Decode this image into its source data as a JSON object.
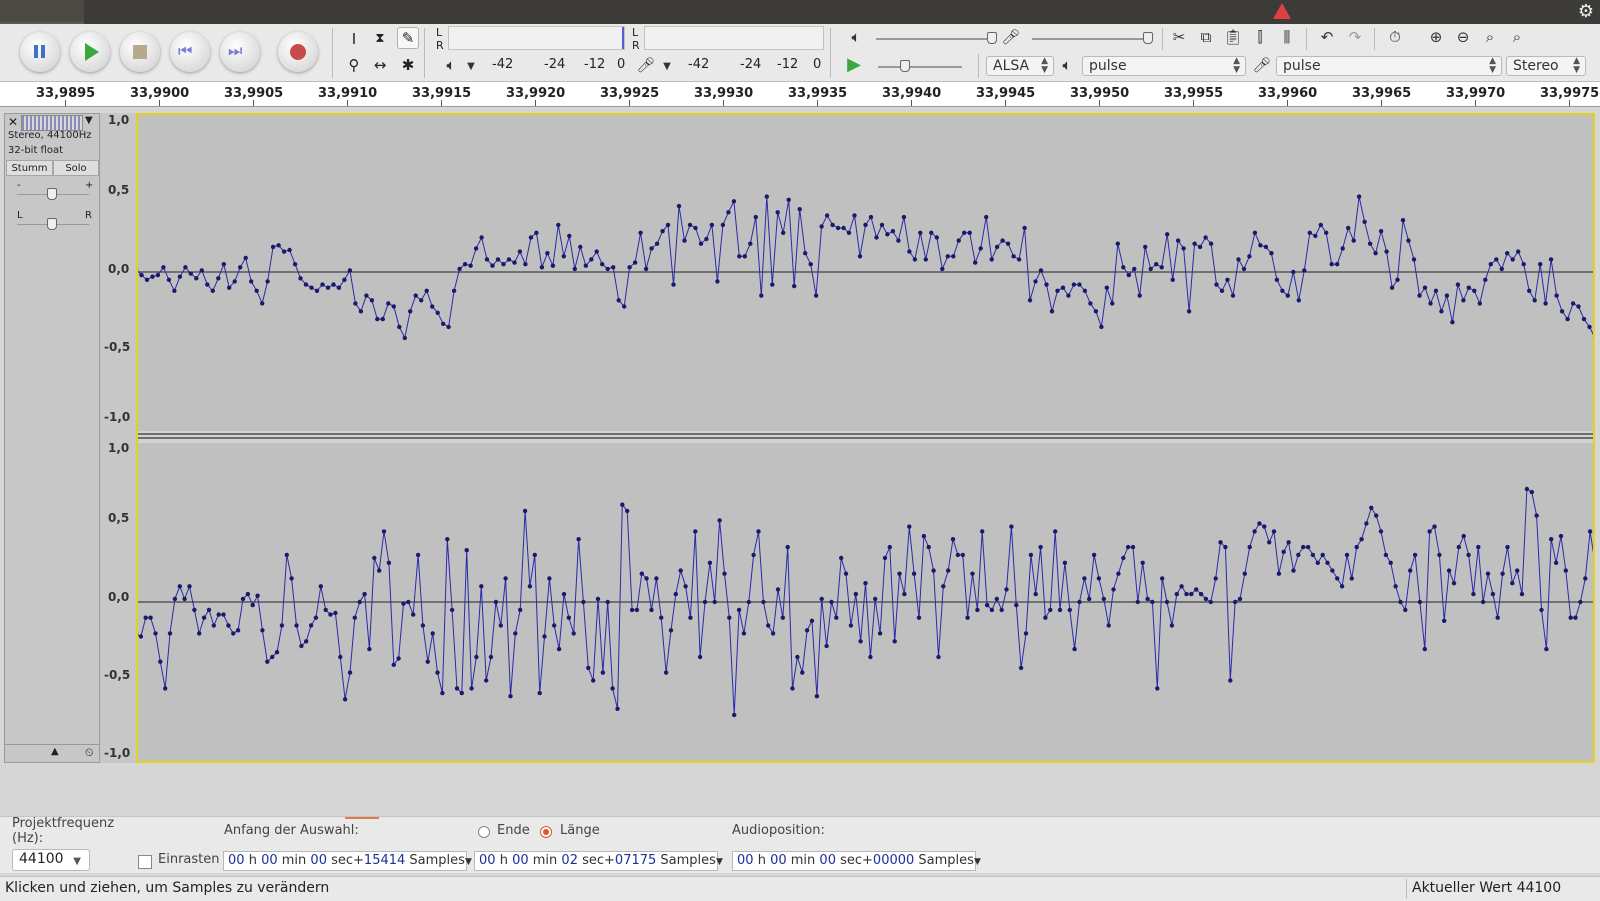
{
  "toolbar": {
    "meter_rec_L": "L",
    "meter_rec_R": "R",
    "meter_play_L": "L",
    "meter_play_R": "R",
    "meter_ticks": [
      "-42",
      "-24",
      "-12",
      "0"
    ],
    "meter_ticks_b": [
      "-42",
      "-24",
      "-12",
      "0"
    ],
    "host": "ALSA",
    "playback_device": "pulse",
    "recording_device": "pulse",
    "channels": "Stereo"
  },
  "ruler": {
    "labels": [
      "33,9895",
      "33,9900",
      "33,9905",
      "33,9910",
      "33,9915",
      "33,9920",
      "33,9925",
      "33,9930",
      "33,9935",
      "33,9940",
      "33,9945",
      "33,9950",
      "33,9955",
      "33,9960",
      "33,9965",
      "33,9970",
      "33,9975"
    ]
  },
  "track": {
    "format": "Stereo, 44100Hz",
    "bitdepth": "32-bit float",
    "mute_label": "Stumm",
    "solo_label": "Solo",
    "gain_minus": "-",
    "gain_plus": "+",
    "pan_left": "L",
    "pan_right": "R"
  },
  "scale": {
    "ch1": [
      "1,0",
      "0,5",
      "0,0",
      "-0,5",
      "-1,0"
    ],
    "ch2": [
      "1,0",
      "0,5",
      "0,0",
      "-0,5",
      "-1,0"
    ]
  },
  "selection": {
    "project_rate_label": "Projektfrequenz (Hz):",
    "project_rate_value": "44100",
    "snap_label": "Einrasten",
    "start_label": "Anfang der Auswahl:",
    "end_label": "Ende",
    "length_label": "Länge",
    "audiopos_label": "Audioposition:",
    "start_tc": {
      "h": "00",
      "min": "00",
      "sec": "00",
      "samples": "15414"
    },
    "length_tc": {
      "h": "00",
      "min": "00",
      "sec": "02",
      "samples": "07175"
    },
    "audio_tc": {
      "h": "00",
      "min": "00",
      "sec": "00",
      "samples": "00000"
    },
    "unit_h": "h",
    "unit_min": "min",
    "unit_sec": "sec+",
    "unit_samples": "Samples"
  },
  "status": {
    "hint": "Klicken und ziehen, um Samples zu verändern",
    "current_value": "Aktueller Wert 44100"
  },
  "colors": {
    "wave": "#2a2aa8",
    "wave_bg": "#c0c0c0",
    "selection_border": "#e2d41a",
    "record_button": "#c84a4a",
    "play_green": "#3aa83a"
  },
  "waveform": {
    "ch1": [
      0.02,
      -0.02,
      -0.05,
      -0.03,
      -0.02,
      0.03,
      -0.05,
      -0.12,
      -0.03,
      0.03,
      -0.01,
      -0.04,
      0.01,
      -0.08,
      -0.12,
      -0.04,
      0.05,
      -0.1,
      -0.06,
      0.03,
      0.09,
      -0.06,
      -0.12,
      -0.2,
      -0.06,
      0.16,
      0.17,
      0.13,
      0.14,
      0.05,
      -0.04,
      -0.08,
      -0.1,
      -0.12,
      -0.08,
      -0.1,
      -0.08,
      -0.1,
      -0.05,
      0.01,
      -0.2,
      -0.25,
      -0.15,
      -0.18,
      -0.3,
      -0.3,
      -0.2,
      -0.22,
      -0.35,
      -0.42,
      -0.25,
      -0.15,
      -0.18,
      -0.12,
      -0.22,
      -0.26,
      -0.33,
      -0.35,
      -0.12,
      0.02,
      0.05,
      0.04,
      0.15,
      0.22,
      0.08,
      0.04,
      0.08,
      0.05,
      0.08,
      0.06,
      0.13,
      0.05,
      0.22,
      0.25,
      0.03,
      0.12,
      0.04,
      0.3,
      0.1,
      0.23,
      0.02,
      0.16,
      0.04,
      0.08,
      0.13,
      0.05,
      0.02,
      0.03,
      -0.18,
      -0.22,
      0.03,
      0.06,
      0.25,
      0.02,
      0.15,
      0.18,
      0.26,
      0.3,
      -0.08,
      0.42,
      0.2,
      0.3,
      0.28,
      0.18,
      0.21,
      0.3,
      -0.06,
      0.3,
      0.38,
      0.45,
      0.1,
      0.1,
      0.18,
      0.35,
      -0.15,
      0.48,
      -0.08,
      0.38,
      0.25,
      0.46,
      -0.09,
      0.4,
      0.12,
      0.05,
      -0.15,
      0.29,
      0.36,
      0.3,
      0.28,
      0.28,
      0.25,
      0.36,
      0.1,
      0.3,
      0.35,
      0.22,
      0.3,
      0.24,
      0.26,
      0.2,
      0.35,
      0.13,
      0.08,
      0.25,
      0.08,
      0.25,
      0.22,
      0.02,
      0.1,
      0.1,
      0.2,
      0.25,
      0.25,
      0.06,
      0.15,
      0.35,
      0.08,
      0.16,
      0.2,
      0.18,
      0.1,
      0.08,
      0.28,
      -0.18,
      -0.06,
      0.01,
      -0.08,
      -0.25,
      -0.12,
      -0.1,
      -0.15,
      -0.08,
      -0.08,
      -0.12,
      -0.2,
      -0.25,
      -0.35,
      -0.1,
      -0.2,
      0.18,
      0.03,
      -0.02,
      0.02,
      -0.15,
      0.16,
      0.02,
      0.05,
      0.03,
      0.24,
      -0.05,
      0.2,
      0.15,
      -0.25,
      0.18,
      0.16,
      0.22,
      0.18,
      -0.08,
      -0.12,
      -0.05,
      -0.15,
      0.08,
      0.02,
      0.1,
      0.25,
      0.17,
      0.16,
      0.12,
      -0.05,
      -0.12,
      -0.15,
      0.0,
      -0.18,
      0.01,
      0.25,
      0.23,
      0.3,
      0.25,
      0.05,
      0.05,
      0.15,
      0.28,
      0.2,
      0.48,
      0.32,
      0.18,
      0.12,
      0.26,
      0.13,
      -0.1,
      -0.05,
      0.33,
      0.2,
      0.08,
      -0.15,
      -0.1,
      -0.2,
      -0.12,
      -0.25,
      -0.15,
      -0.32,
      -0.08,
      -0.18,
      -0.1,
      -0.12,
      -0.2,
      -0.05,
      0.05,
      0.08,
      0.02,
      0.12,
      0.08,
      0.13,
      0.05,
      -0.12,
      -0.18,
      0.05,
      -0.2,
      0.08,
      -0.15,
      -0.25,
      -0.3,
      -0.2,
      -0.22,
      -0.3,
      -0.35,
      -0.42
    ],
    "ch2": [
      -0.2,
      -0.22,
      -0.1,
      -0.1,
      -0.2,
      -0.38,
      -0.55,
      -0.2,
      0.02,
      0.1,
      0.02,
      0.1,
      -0.05,
      -0.2,
      -0.1,
      -0.05,
      -0.15,
      -0.08,
      -0.08,
      -0.15,
      -0.2,
      -0.18,
      0.02,
      0.05,
      -0.02,
      0.04,
      -0.18,
      -0.38,
      -0.35,
      -0.32,
      -0.15,
      0.3,
      0.15,
      -0.15,
      -0.28,
      -0.25,
      -0.15,
      -0.1,
      0.1,
      -0.05,
      -0.08,
      -0.07,
      -0.35,
      -0.62,
      -0.45,
      -0.1,
      0.0,
      0.05,
      -0.3,
      0.28,
      0.2,
      0.45,
      0.25,
      -0.4,
      -0.36,
      -0.01,
      0.0,
      -0.08,
      0.3,
      -0.15,
      -0.38,
      -0.2,
      -0.45,
      -0.58,
      0.4,
      -0.05,
      -0.55,
      -0.58,
      0.33,
      -0.55,
      -0.35,
      0.1,
      -0.5,
      -0.35,
      0.0,
      -0.15,
      0.15,
      -0.6,
      -0.2,
      -0.05,
      0.58,
      0.1,
      0.3,
      -0.58,
      -0.22,
      0.15,
      -0.15,
      -0.3,
      0.05,
      -0.1,
      -0.2,
      0.4,
      0.0,
      -0.42,
      -0.5,
      0.02,
      -0.45,
      0.0,
      -0.55,
      -0.68,
      0.62,
      0.58,
      -0.05,
      -0.05,
      0.18,
      0.15,
      -0.05,
      0.15,
      -0.1,
      -0.45,
      -0.18,
      0.05,
      0.2,
      0.1,
      -0.1,
      0.45,
      -0.35,
      0.0,
      0.25,
      0.0,
      0.52,
      0.18,
      -0.1,
      -0.72,
      -0.05,
      -0.2,
      0.0,
      0.3,
      0.45,
      0.0,
      -0.15,
      -0.2,
      0.08,
      -0.1,
      0.35,
      -0.55,
      -0.35,
      -0.45,
      -0.18,
      -0.12,
      -0.6,
      0.02,
      -0.28,
      0.0,
      -0.1,
      0.28,
      0.18,
      -0.15,
      0.05,
      -0.25,
      0.12,
      -0.35,
      0.02,
      -0.2,
      0.28,
      0.35,
      -0.25,
      0.18,
      0.05,
      0.48,
      0.18,
      -0.1,
      0.42,
      0.35,
      0.2,
      -0.35,
      0.1,
      0.2,
      0.4,
      0.3,
      0.3,
      -0.1,
      0.18,
      -0.05,
      0.45,
      -0.02,
      -0.05,
      0.02,
      -0.05,
      0.08,
      0.48,
      -0.02,
      -0.42,
      -0.2,
      0.3,
      0.05,
      0.35,
      -0.1,
      -0.05,
      0.45,
      -0.05,
      0.25,
      -0.05,
      -0.3,
      0.0,
      0.15,
      0.02,
      0.3,
      0.15,
      0.02,
      -0.15,
      0.08,
      0.18,
      0.28,
      0.35,
      0.35,
      0.0,
      0.25,
      0.02,
      0.0,
      -0.55,
      0.15,
      0.0,
      -0.15,
      0.05,
      0.1,
      0.05,
      0.05,
      0.08,
      0.05,
      0.02,
      0.0,
      0.15,
      0.38,
      0.35,
      -0.5,
      0.0,
      0.02,
      0.18,
      0.35,
      0.45,
      0.5,
      0.48,
      0.38,
      0.45,
      0.18,
      0.32,
      0.38,
      0.2,
      0.3,
      0.35,
      0.35,
      0.3,
      0.25,
      0.3,
      0.25,
      0.2,
      0.15,
      0.1,
      0.3,
      0.15,
      0.35,
      0.4,
      0.5,
      0.6,
      0.55,
      0.45,
      0.3,
      0.25,
      0.1,
      0.0,
      -0.05,
      0.2,
      0.3,
      0.0,
      -0.3,
      0.45,
      0.48,
      0.3,
      -0.12,
      0.2,
      0.12,
      0.35,
      0.42,
      0.3,
      0.05,
      0.35,
      0.0,
      0.18,
      0.05,
      -0.1,
      0.18,
      0.35,
      0.12,
      0.2,
      0.05,
      0.72,
      0.7,
      0.55,
      -0.05,
      -0.3,
      0.4,
      0.25,
      0.42,
      0.2,
      -0.1,
      -0.1,
      0.0,
      0.15,
      0.45,
      0.25
    ]
  }
}
